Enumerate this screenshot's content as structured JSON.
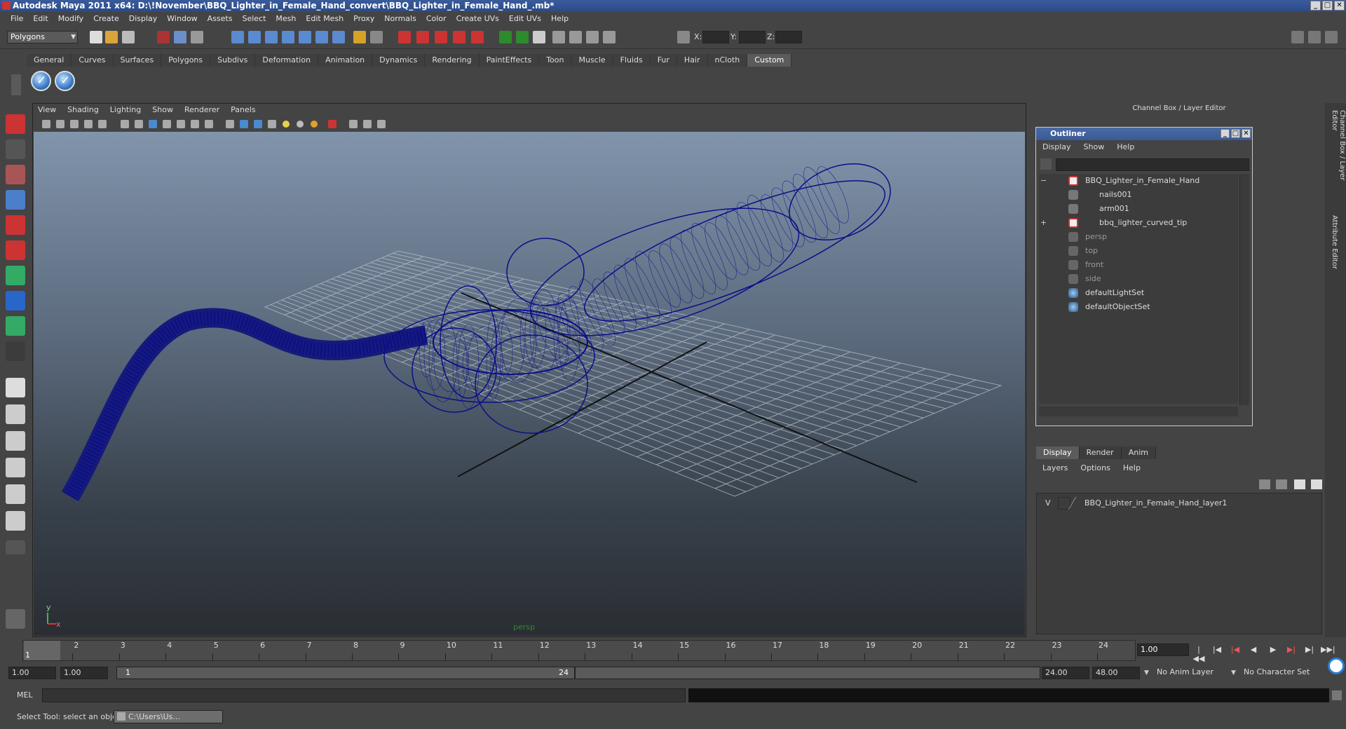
{
  "window": {
    "title": "Autodesk Maya 2011 x64: D:\\!November\\BBQ_Lighter_in_Female_Hand_convert\\BBQ_Lighter_in_Female_Hand_.mb*"
  },
  "menubar": [
    "File",
    "Edit",
    "Modify",
    "Create",
    "Display",
    "Window",
    "Assets",
    "Select",
    "Mesh",
    "Edit Mesh",
    "Proxy",
    "Normals",
    "Color",
    "Create UVs",
    "Edit UVs",
    "Help"
  ],
  "statusline": {
    "mode": "Polygons",
    "x_label": "X:",
    "y_label": "Y:",
    "z_label": "Z:"
  },
  "shelf": {
    "tabs": [
      "General",
      "Curves",
      "Surfaces",
      "Polygons",
      "Subdivs",
      "Deformation",
      "Animation",
      "Dynamics",
      "Rendering",
      "PaintEffects",
      "Toon",
      "Muscle",
      "Fluids",
      "Fur",
      "Hair",
      "nCloth",
      "Custom"
    ],
    "active_tab": "Custom"
  },
  "viewport": {
    "menu": [
      "View",
      "Shading",
      "Lighting",
      "Show",
      "Renderer",
      "Panels"
    ],
    "camera_label": "persp",
    "axis_x": "x",
    "axis_y": "y"
  },
  "channel_box": {
    "header": "Channel Box / Layer Editor",
    "side_tab_1": "Channel Box / Layer Editor",
    "side_tab_2": "Attribute Editor"
  },
  "outliner": {
    "title": "Outliner",
    "menu": [
      "Display",
      "Show",
      "Help"
    ],
    "items": [
      {
        "label": "BBQ_Lighter_in_Female_Hand",
        "type": "group",
        "expand": "−"
      },
      {
        "label": "nails001",
        "type": "mesh"
      },
      {
        "label": "arm001",
        "type": "mesh"
      },
      {
        "label": "bbq_lighter_curved_tip",
        "type": "group",
        "expand": "+"
      },
      {
        "label": "persp",
        "type": "camera",
        "dim": true
      },
      {
        "label": "top",
        "type": "camera",
        "dim": true
      },
      {
        "label": "front",
        "type": "camera",
        "dim": true
      },
      {
        "label": "side",
        "type": "camera",
        "dim": true
      },
      {
        "label": "defaultLightSet",
        "type": "set"
      },
      {
        "label": "defaultObjectSet",
        "type": "set"
      }
    ]
  },
  "layer_editor": {
    "tabs": [
      "Display",
      "Render",
      "Anim"
    ],
    "active_tab": "Display",
    "menu": [
      "Layers",
      "Options",
      "Help"
    ],
    "layers": [
      {
        "visible": "V",
        "name": "BBQ_Lighter_in_Female_Hand_layer1"
      }
    ]
  },
  "timeline": {
    "ticks": [
      "1",
      "2",
      "3",
      "4",
      "5",
      "6",
      "7",
      "8",
      "9",
      "10",
      "11",
      "12",
      "13",
      "14",
      "15",
      "16",
      "17",
      "18",
      "19",
      "20",
      "21",
      "22",
      "23",
      "24"
    ],
    "current_frame": "1.00",
    "playhead_label": "1"
  },
  "range": {
    "start": "1.00",
    "playback_start": "1.00",
    "slider_start": "1",
    "slider_end": "24",
    "playback_end": "24.00",
    "end": "48.00",
    "anim_layer": "No Anim Layer",
    "character_set": "No Character Set"
  },
  "command": {
    "label": "MEL"
  },
  "help": {
    "text": "Select Tool: select an object",
    "taskbar_item": "C:\\Users\\Us..."
  }
}
